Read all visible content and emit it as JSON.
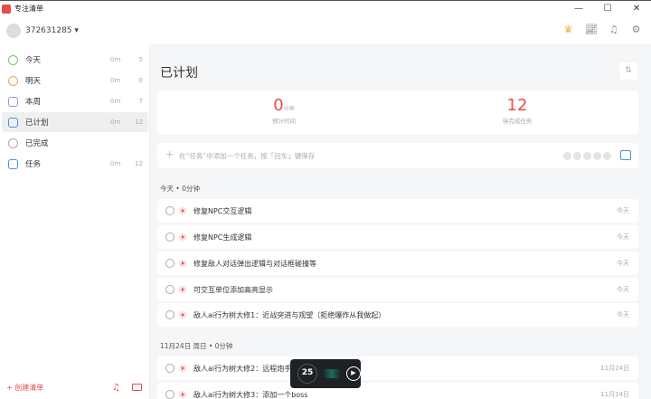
{
  "app": {
    "title": "专注清单",
    "window_controls": [
      "—",
      "☐",
      "✕"
    ]
  },
  "header": {
    "user": "372631285 ▾",
    "icons": [
      "crown-icon",
      "stats-icon",
      "bell-icon",
      "gear-icon"
    ]
  },
  "sidebar": {
    "items": [
      {
        "label": "今天",
        "min": "0m",
        "count": "5",
        "color": "#7ac46a"
      },
      {
        "label": "明天",
        "min": "0m",
        "count": "0",
        "color": "#f0a060"
      },
      {
        "label": "本周",
        "min": "0m",
        "count": "7",
        "color": "#a28ee6"
      },
      {
        "label": "已计划",
        "min": "0m",
        "count": "12",
        "color": "#4a90e2"
      },
      {
        "label": "已完成",
        "min": "",
        "count": "",
        "color": "#aaaaaa"
      },
      {
        "label": "任务",
        "min": "0m",
        "count": "12",
        "color": "#4a90e2"
      }
    ],
    "create_label": "+ 创建清单"
  },
  "main": {
    "title": "已计划",
    "sort": "⇅",
    "stats": [
      {
        "value": "0",
        "unit": "分钟",
        "caption": "预计时间"
      },
      {
        "value": "12",
        "unit": "",
        "caption": "待完成任务"
      }
    ],
    "add_placeholder": "在“任务”中添加一个任务，按「回车」键保存",
    "sections": [
      {
        "header": "今天 • 0分钟",
        "tasks": [
          {
            "title": "修复NPC交互逻辑",
            "date": "今天"
          },
          {
            "title": "修复NPC生成逻辑",
            "date": "今天"
          },
          {
            "title": "修复敌人对话弹出逻辑与对话框碰撞等",
            "date": "今天"
          },
          {
            "title": "可交互单位添加高亮显示",
            "date": "今天"
          },
          {
            "title": "敌人ai行为树大修1：近战突进与观望（拒绝爆炸从我做起）",
            "date": "今天"
          }
        ]
      },
      {
        "header": "11月24日 周日 • 0分钟",
        "tasks": [
          {
            "title": "敌人ai行为树大修2：远程炮手",
            "date": "11月24日"
          },
          {
            "title": "敌人ai行为树大修3：添加一个boss",
            "date": "11月24日"
          }
        ]
      }
    ]
  },
  "pomodoro": {
    "minutes": "25",
    "play": "▶"
  }
}
